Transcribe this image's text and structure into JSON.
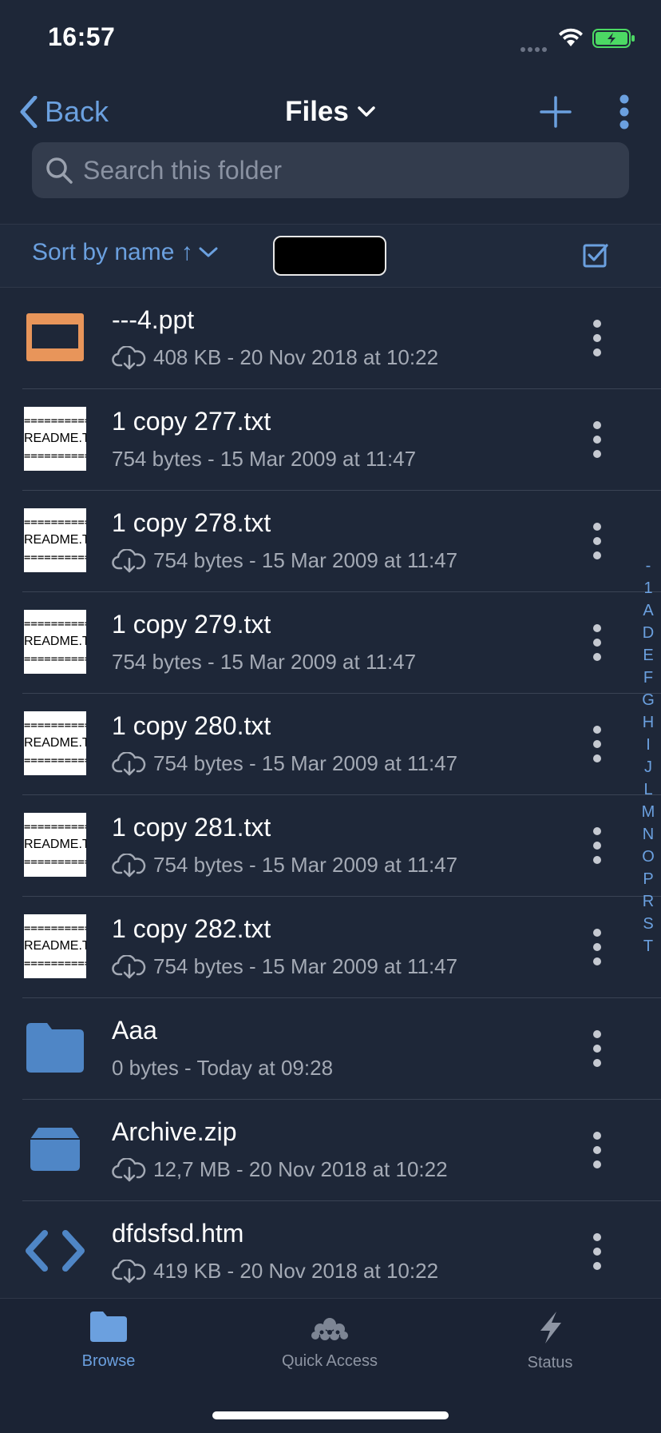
{
  "status": {
    "time": "16:57"
  },
  "nav": {
    "back_label": "Back",
    "title": "Files"
  },
  "search": {
    "placeholder": "Search this folder"
  },
  "sort": {
    "label": "Sort by name ↑"
  },
  "files": [
    {
      "name": "---4.ppt",
      "meta": "408 KB - 20 Nov 2018 at 10:22",
      "icon": "presentation-icon",
      "cloud": true
    },
    {
      "name": "1 copy 277.txt",
      "meta": "754 bytes - 15 Mar 2009 at 11:47",
      "icon": "readme-thumbnail",
      "cloud": false
    },
    {
      "name": "1 copy 278.txt",
      "meta": "754 bytes - 15 Mar 2009 at 11:47",
      "icon": "readme-thumbnail",
      "cloud": true
    },
    {
      "name": "1 copy 279.txt",
      "meta": "754 bytes - 15 Mar 2009 at 11:47",
      "icon": "readme-thumbnail",
      "cloud": false
    },
    {
      "name": "1 copy 280.txt",
      "meta": "754 bytes - 15 Mar 2009 at 11:47",
      "icon": "readme-thumbnail",
      "cloud": true
    },
    {
      "name": "1 copy 281.txt",
      "meta": "754 bytes - 15 Mar 2009 at 11:47",
      "icon": "readme-thumbnail",
      "cloud": true
    },
    {
      "name": "1 copy 282.txt",
      "meta": "754 bytes - 15 Mar 2009 at 11:47",
      "icon": "readme-thumbnail",
      "cloud": true
    },
    {
      "name": "Aaa",
      "meta": "0 bytes - Today at 09:28",
      "icon": "folder-icon",
      "cloud": false
    },
    {
      "name": "Archive.zip",
      "meta": "12,7 MB - 20 Nov 2018 at 10:22",
      "icon": "archive-icon",
      "cloud": true
    },
    {
      "name": "dfdsfsd.htm",
      "meta": "419 KB - 20 Nov 2018 at 10:22",
      "icon": "code-icon",
      "cloud": true
    }
  ],
  "thumbnail_text": {
    "rule": "==========",
    "label": "README.T"
  },
  "index_letters": [
    "-",
    "1",
    "A",
    "D",
    "E",
    "F",
    "G",
    "H",
    "I",
    "J",
    "L",
    "M",
    "N",
    "O",
    "P",
    "R",
    "S",
    "T"
  ],
  "tabs": [
    {
      "label": "Browse",
      "icon": "folder-icon",
      "active": true
    },
    {
      "label": "Quick Access",
      "icon": "cloud-icon",
      "active": false
    },
    {
      "label": "Status",
      "icon": "bolt-icon",
      "active": false
    }
  ],
  "colors": {
    "background": "#1e2738",
    "accent": "#6ba0df",
    "secondary_text": "#a4aab5",
    "ppt_orange": "#e8955a",
    "folder_blue": "#4f86c6",
    "battery_green": "#4cd964"
  }
}
